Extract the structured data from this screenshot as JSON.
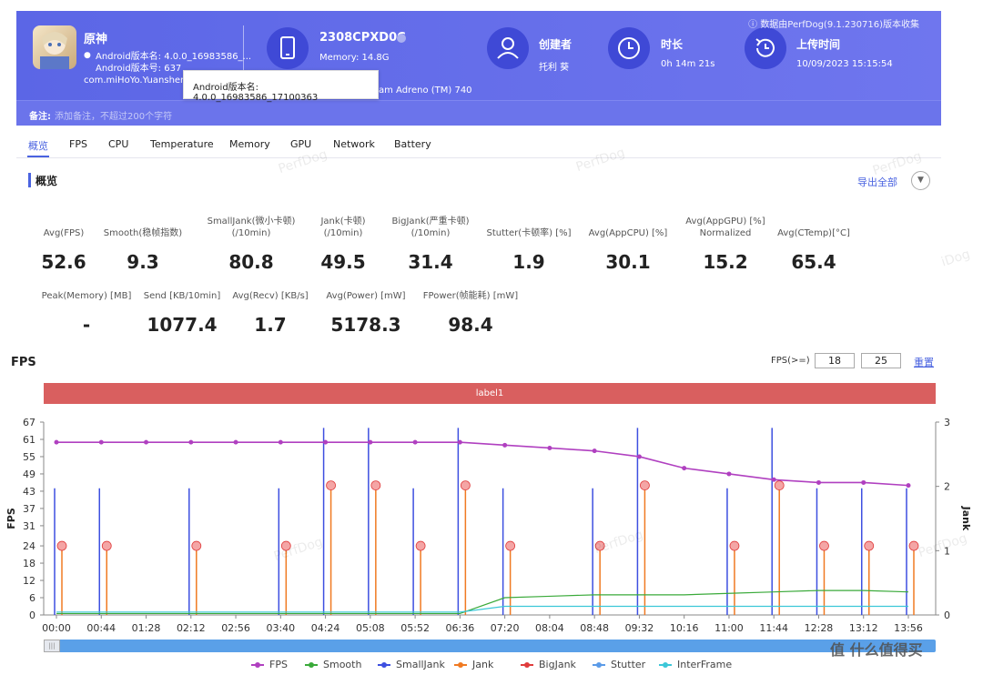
{
  "header": {
    "app_name": "原神",
    "android_version_name": "Android版本名: 4.0.0_16983586_...",
    "android_version_code": "Android版本号: 637",
    "package": "com.miHoYo.Yuanshen",
    "device": "2308CPXD0C",
    "memory": "Memory: 14.8G",
    "gpu": "am Adreno (TM) 740",
    "creator_label": "创建者",
    "creator_value": "托利 葵",
    "duration_label": "时长",
    "duration_value": "0h 14m 21s",
    "upload_label": "上传时间",
    "upload_value": "10/09/2023 15:15:54",
    "source_note": "数据由PerfDog(9.1.230716)版本收集",
    "remark_label": "备注:",
    "remark_placeholder": "添加备注，不超过200个字符",
    "tooltip": "Android版本名: 4.0.0_16983586_17100363"
  },
  "tabs": [
    "概览",
    "FPS",
    "CPU",
    "Temperature",
    "Memory",
    "GPU",
    "Network",
    "Battery"
  ],
  "overview": {
    "title": "概览",
    "export_all": "导出全部",
    "row1": [
      {
        "label": "Avg(FPS)",
        "value": "52.6"
      },
      {
        "label": "Smooth(稳帧指数)",
        "value": "9.3"
      },
      {
        "label": "SmallJank(微小卡顿)\n(/10min)",
        "value": "80.8"
      },
      {
        "label": "Jank(卡顿)\n(/10min)",
        "value": "49.5"
      },
      {
        "label": "BigJank(严重卡顿)\n(/10min)",
        "value": "31.4"
      },
      {
        "label": "Stutter(卡顿率) [%]",
        "value": "1.9"
      },
      {
        "label": "Avg(AppCPU) [%]",
        "value": "30.1"
      },
      {
        "label": "Avg(AppGPU) [%]\nNormalized",
        "value": "15.2"
      },
      {
        "label": "Avg(CTemp)[°C]",
        "value": "65.4"
      }
    ],
    "row2": [
      {
        "label": "Peak(Memory) [MB]",
        "value": "-"
      },
      {
        "label": "Send [KB/10min]",
        "value": "1077.4"
      },
      {
        "label": "Avg(Recv) [KB/s]",
        "value": "1.7"
      },
      {
        "label": "Avg(Power) [mW]",
        "value": "5178.3"
      },
      {
        "label": "FPower(帧能耗) [mW]",
        "value": "98.4"
      }
    ]
  },
  "fps_panel": {
    "title": "FPS",
    "threshold_label": "FPS(>=)",
    "threshold_1": "18",
    "threshold_2": "25",
    "reset": "重置",
    "band_label": "label1"
  },
  "watermarks": [
    "PerfDog",
    "iDog",
    "值 什么值得买"
  ],
  "colors": {
    "header_bg": "#5b66e6",
    "fps": "#b040c0",
    "smooth": "#3aaa3a",
    "smalljank": "#3d4fe0",
    "jank": "#f07a22",
    "bigjank": "#e03c3c",
    "stutter": "#5b9be8",
    "interframe": "#3cc7d8",
    "band": "#d95f5f"
  },
  "chart_data": {
    "type": "line",
    "xlabel": "",
    "ylabel": "FPS",
    "y2label": "Jank",
    "ylim": [
      0,
      67
    ],
    "y2lim": [
      0,
      3
    ],
    "yticks": [
      0,
      6,
      12,
      18,
      24,
      31,
      37,
      43,
      49,
      55,
      61,
      67
    ],
    "y2ticks": [
      0,
      1,
      2,
      3
    ],
    "x": [
      "00:00",
      "00:44",
      "01:28",
      "02:12",
      "02:56",
      "03:40",
      "04:24",
      "05:08",
      "05:52",
      "06:36",
      "07:20",
      "08:04",
      "08:48",
      "09:32",
      "10:16",
      "11:00",
      "11:44",
      "12:28",
      "13:12",
      "13:56"
    ],
    "legend": [
      "FPS",
      "Smooth",
      "SmallJank",
      "Jank",
      "BigJank",
      "Stutter",
      "InterFrame"
    ],
    "series": [
      {
        "name": "FPS",
        "values": [
          60,
          60,
          60,
          60,
          60,
          60,
          60,
          60,
          60,
          60,
          59,
          58,
          57,
          55,
          51,
          49,
          47,
          46,
          46,
          45
        ]
      },
      {
        "name": "Smooth",
        "values": [
          0.5,
          0.5,
          0.5,
          0.5,
          0.5,
          0.5,
          0.5,
          0.5,
          0.5,
          0.5,
          6,
          6.5,
          7,
          7,
          7,
          7.5,
          8,
          8.5,
          8.5,
          8
        ]
      },
      {
        "name": "Stutter",
        "values": [
          1,
          1,
          1,
          1,
          1,
          1,
          1,
          1,
          1,
          1,
          3,
          3,
          3,
          3,
          3,
          3,
          3,
          3,
          3,
          3
        ]
      },
      {
        "name": "BigJank",
        "values": [
          24,
          24,
          0,
          24,
          0,
          24,
          45,
          45,
          24,
          45,
          24,
          0,
          24,
          45,
          0,
          24,
          45,
          24,
          24,
          24
        ]
      }
    ]
  }
}
